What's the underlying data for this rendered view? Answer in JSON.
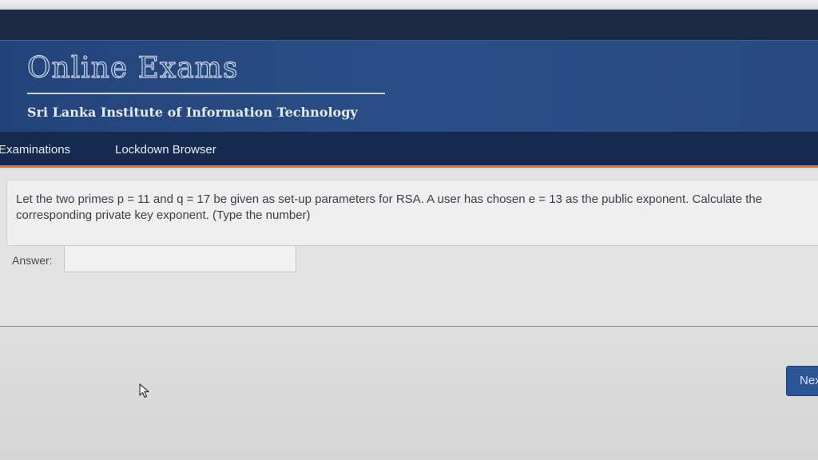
{
  "header": {
    "site_title": "Online Exams",
    "site_subtitle": "Sri Lanka Institute of Information Technology"
  },
  "nav": {
    "items": [
      {
        "label": "Examinations"
      },
      {
        "label": "Lockdown Browser"
      }
    ]
  },
  "question": {
    "text": "Let the two primes p = 11 and q = 17 be given as set-up parameters for RSA. A user has chosen e = 13 as the public exponent. Calculate the corresponding private key exponent. (Type the number)",
    "answer_label": "Answer:",
    "answer_value": ""
  },
  "footer": {
    "next_label": "Next"
  },
  "colors": {
    "header_blue": "#2a4e86",
    "nav_dark": "#142a4e",
    "nav_accent": "#d9782a",
    "next_button": "#2c5596"
  },
  "icons": {
    "cursor": "mouse-pointer-icon"
  }
}
